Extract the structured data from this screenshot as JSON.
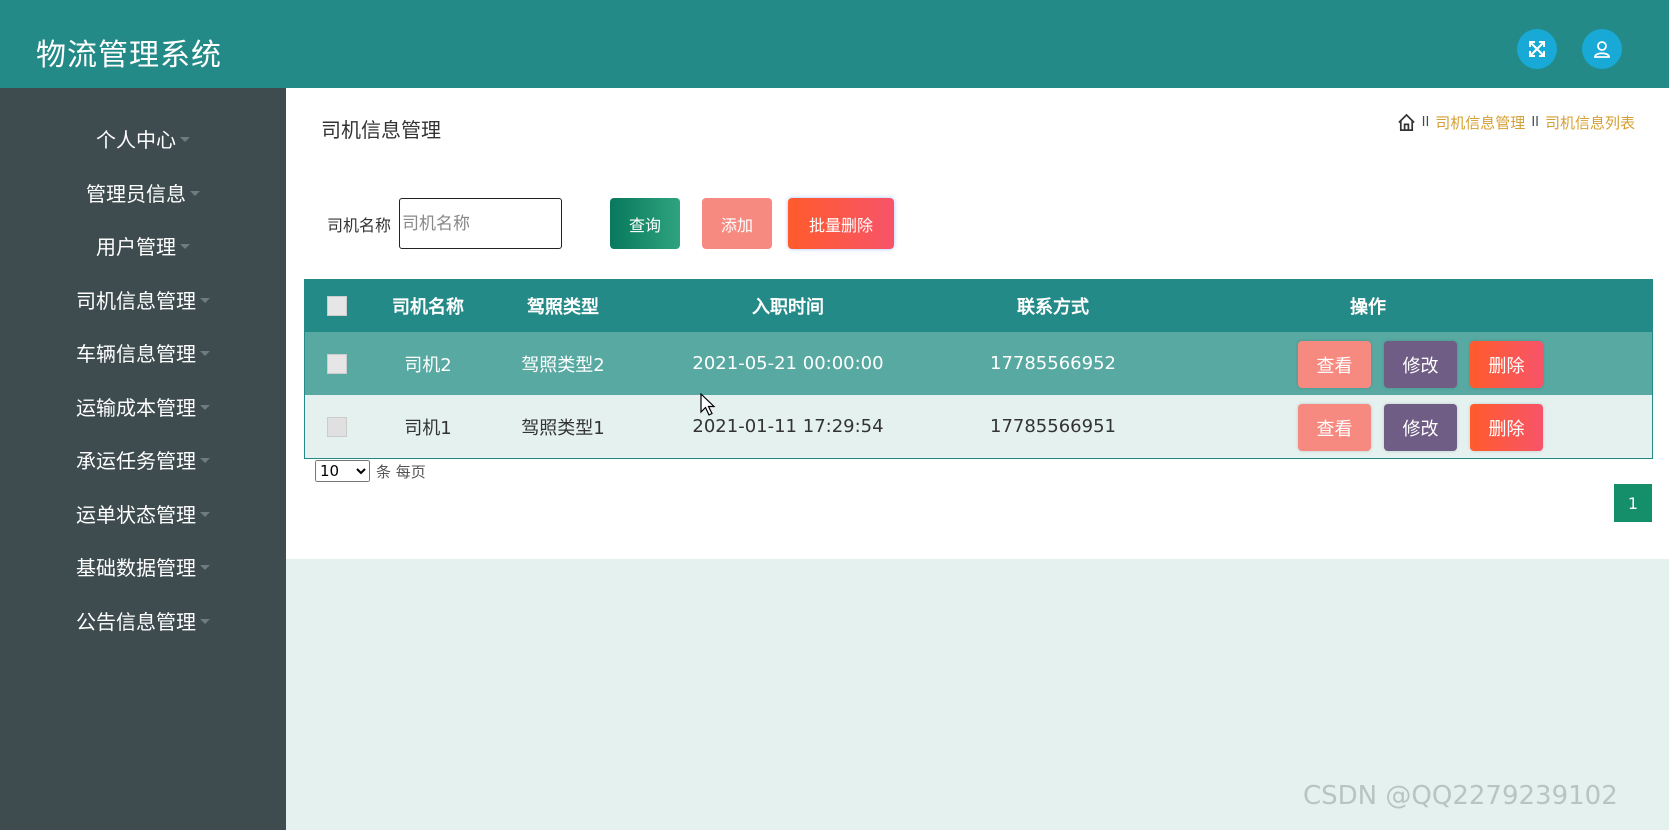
{
  "header": {
    "title": "物流管理系统",
    "icons": [
      "fullscreen-icon",
      "user-icon"
    ]
  },
  "sidebar": {
    "items": [
      {
        "label": "个人中心"
      },
      {
        "label": "管理员信息"
      },
      {
        "label": "用户管理"
      },
      {
        "label": "司机信息管理"
      },
      {
        "label": "车辆信息管理"
      },
      {
        "label": "运输成本管理"
      },
      {
        "label": "承运任务管理"
      },
      {
        "label": "运单状态管理"
      },
      {
        "label": "基础数据管理"
      },
      {
        "label": "公告信息管理"
      }
    ]
  },
  "main": {
    "title": "司机信息管理",
    "breadcrumb": {
      "sep": "II",
      "items": [
        "司机信息管理",
        "司机信息列表"
      ]
    },
    "search": {
      "label": "司机名称",
      "placeholder": "司机名称",
      "value": ""
    },
    "buttons": {
      "query": "查询",
      "add": "添加",
      "batch_delete": "批量删除"
    },
    "table": {
      "headers": [
        "司机名称",
        "驾照类型",
        "入职时间",
        "联系方式",
        "操作"
      ],
      "rows": [
        {
          "name": "司机2",
          "license": "驾照类型2",
          "hire_time": "2021-05-21 00:00:00",
          "phone": "17785566952"
        },
        {
          "name": "司机1",
          "license": "驾照类型1",
          "hire_time": "2021-01-11 17:29:54",
          "phone": "17785566951"
        }
      ],
      "actions": {
        "view": "查看",
        "edit": "修改",
        "delete": "删除"
      }
    },
    "pagination": {
      "page_size": "10",
      "page_size_suffix": "条 每页",
      "current_page": "1"
    }
  },
  "watermark": "CSDN @QQ2279239102",
  "colors": {
    "header": "#238a87",
    "sidebar": "#3e4b4f",
    "accent": "#18a9d6",
    "row_highlight": "#58a9a2"
  }
}
